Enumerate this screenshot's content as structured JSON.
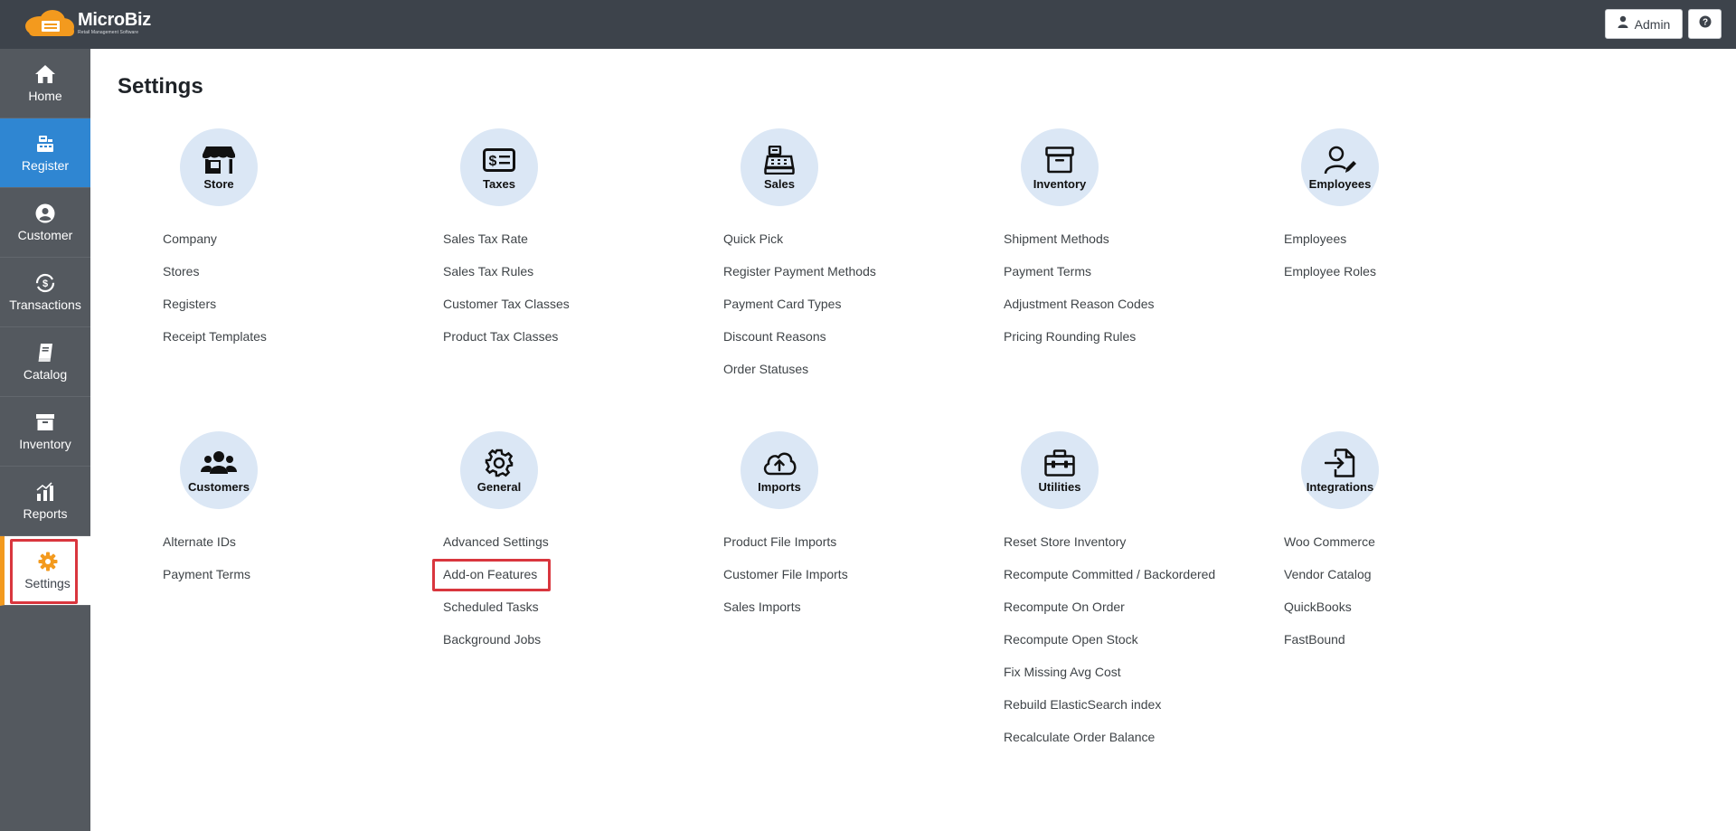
{
  "app": {
    "logo_title": "MicroBiz",
    "logo_subtitle": "Retail Management Software",
    "user_label": "Admin",
    "help_label": "?"
  },
  "sidebar": {
    "items": [
      {
        "label": "Home",
        "icon": "home-icon"
      },
      {
        "label": "Register",
        "icon": "register-icon"
      },
      {
        "label": "Customer",
        "icon": "user-circle-icon"
      },
      {
        "label": "Transactions",
        "icon": "dollar-cycle-icon"
      },
      {
        "label": "Catalog",
        "icon": "book-icon"
      },
      {
        "label": "Inventory",
        "icon": "archive-icon"
      },
      {
        "label": "Reports",
        "icon": "bar-chart-icon"
      },
      {
        "label": "Settings",
        "icon": "gear-icon"
      }
    ],
    "active": "Settings"
  },
  "page": {
    "title": "Settings"
  },
  "sections": {
    "store": {
      "label": "Store",
      "icon": "store-icon",
      "links": [
        "Company",
        "Stores",
        "Registers",
        "Receipt Templates"
      ]
    },
    "taxes": {
      "label": "Taxes",
      "icon": "money-bill-icon",
      "links": [
        "Sales Tax Rate",
        "Sales Tax Rules",
        "Customer Tax Classes",
        "Product Tax Classes"
      ]
    },
    "sales": {
      "label": "Sales",
      "icon": "cash-register-icon",
      "links": [
        "Quick Pick",
        "Register Payment Methods",
        "Payment Card Types",
        "Discount Reasons",
        "Order Statuses"
      ]
    },
    "inventory": {
      "label": "Inventory",
      "icon": "archive-icon",
      "links": [
        "Shipment Methods",
        "Payment Terms",
        "Adjustment Reason Codes",
        "Pricing Rounding Rules"
      ]
    },
    "employees": {
      "label": "Employees",
      "icon": "user-edit-icon",
      "links": [
        "Employees",
        "Employee Roles"
      ]
    },
    "customers": {
      "label": "Customers",
      "icon": "users-icon",
      "links": [
        "Alternate IDs",
        "Payment Terms"
      ]
    },
    "general": {
      "label": "General",
      "icon": "gear-icon",
      "links": [
        "Advanced Settings",
        "Add-on Features",
        "Scheduled Tasks",
        "Background Jobs"
      ]
    },
    "imports": {
      "label": "Imports",
      "icon": "cloud-upload-icon",
      "links": [
        "Product File Imports",
        "Customer File Imports",
        "Sales Imports"
      ]
    },
    "utilities": {
      "label": "Utilities",
      "icon": "toolbox-icon",
      "links": [
        "Reset Store Inventory",
        "Recompute Committed / Backordered",
        "Recompute On Order",
        "Recompute Open Stock",
        "Fix Missing Avg Cost",
        "Rebuild ElasticSearch index",
        "Recalculate Order Balance"
      ]
    },
    "integrations": {
      "label": "Integrations",
      "icon": "file-import-icon",
      "links": [
        "Woo Commerce",
        "Vendor Catalog",
        "QuickBooks",
        "FastBound"
      ]
    }
  },
  "colors": {
    "topbar": "#3d434b",
    "sidebar": "#54595f",
    "active_blue": "#2f86d2",
    "accent_orange": "#f39a1e",
    "circle_bg": "#dbe7f5",
    "highlight_red": "#d9363e"
  }
}
